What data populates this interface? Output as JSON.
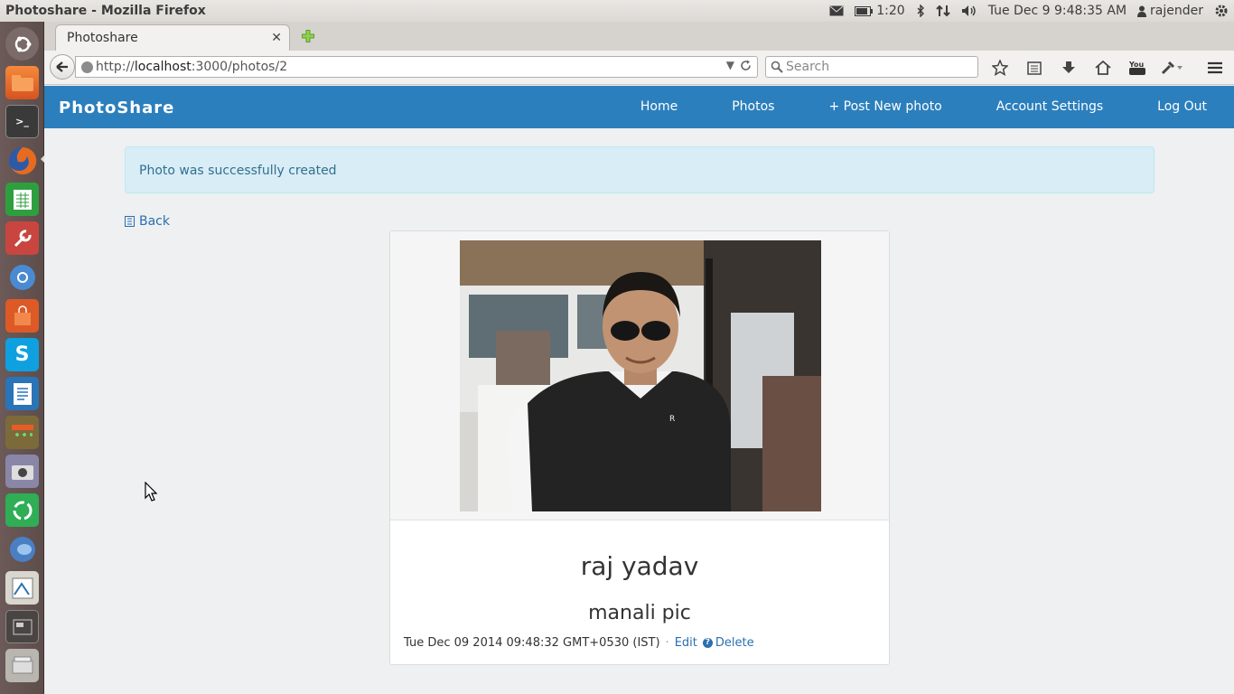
{
  "os_panel": {
    "window_title": "Photoshare - Mozilla Firefox",
    "battery_time": "1:20",
    "datetime": "Tue Dec  9  9:48:35 AM",
    "user": "rajender"
  },
  "launcher": {
    "items": [
      "dash-home",
      "files",
      "terminal",
      "firefox",
      "spreadsheet",
      "settings-tools",
      "chromium",
      "software-center",
      "skype",
      "writer",
      "calculator",
      "camera",
      "update-manager",
      "bird-app",
      "image-editor",
      "workspaces",
      "trash"
    ]
  },
  "browser": {
    "tab_title": "Photoshare",
    "url_prefix": "http://",
    "url_host": "localhost",
    "url_rest": ":3000/photos/2",
    "search_placeholder": "Search"
  },
  "site": {
    "brand": "PhotoShare",
    "nav": [
      "Home",
      "Photos",
      "+ Post New photo",
      "Account Settings",
      "Log Out"
    ]
  },
  "notice": "Photo was successfully created",
  "back_label": "Back",
  "photo": {
    "name": "raj yadav",
    "description": "manali pic",
    "timestamp": "Tue Dec 09 2014 09:48:32 GMT+0530 (IST)",
    "separator": "·",
    "edit_label": "Edit",
    "help_glyph": "?",
    "delete_label": "Delete"
  },
  "colors": {
    "navbar": "#2c7fbd",
    "alert_bg": "#d9edf7",
    "alert_text": "#31708f",
    "link": "#2a6fb0",
    "launcher": "#5f4f4d"
  }
}
